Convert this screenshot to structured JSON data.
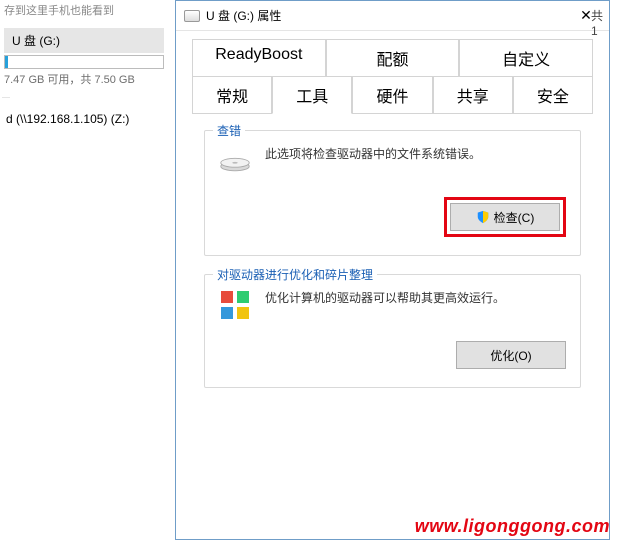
{
  "left": {
    "hint": "存到这里手机也能看到",
    "drive_label": "U 盘 (G:)",
    "drive_subtext": "7.47 GB 可用，共 7.50 GB",
    "drive_fill_percent": 2,
    "network_drive": "d (\\\\192.168.1.105) (Z:)"
  },
  "dialog": {
    "title": "U 盘 (G:) 属性",
    "tabs_row1": [
      "ReadyBoost",
      "配额",
      "自定义"
    ],
    "tabs_row2": [
      "常规",
      "工具",
      "硬件",
      "共享",
      "安全"
    ],
    "active_tab": "工具",
    "check": {
      "group_title": "查错",
      "text": "此选项将检查驱动器中的文件系统错误。",
      "button": "检查(C)"
    },
    "optimize": {
      "group_title": "对驱动器进行优化和碎片整理",
      "text": "优化计算机的驱动器可以帮助其更高效运行。",
      "button": "优化(O)"
    }
  },
  "outside": "共 1",
  "watermark": "www.ligonggong.com"
}
